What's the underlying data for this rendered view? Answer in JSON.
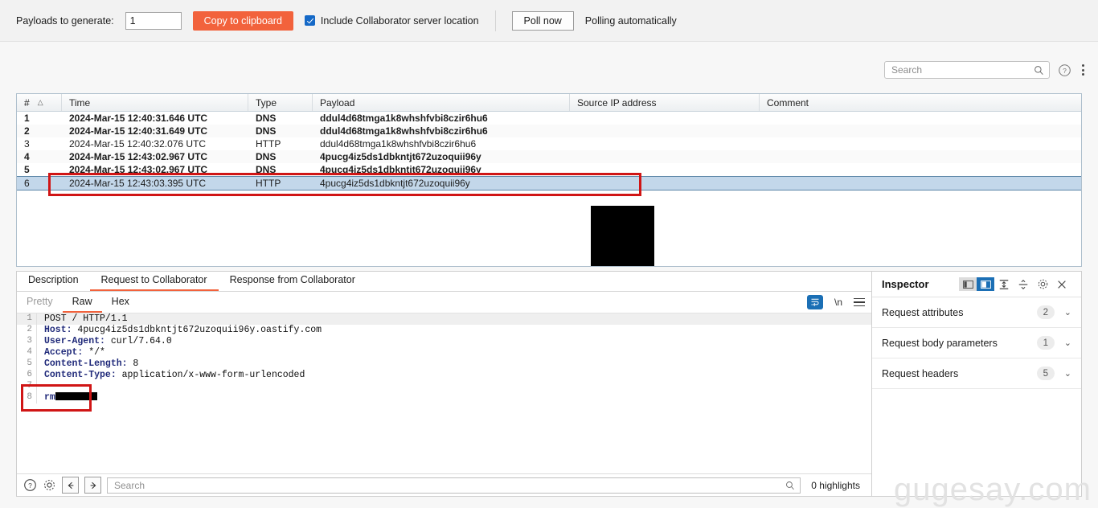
{
  "toolbar": {
    "payloads_label": "Payloads to generate:",
    "payloads_value": "1",
    "copy_button": "Copy to clipboard",
    "include_location_label": "Include Collaborator server location",
    "include_location_checked": true,
    "poll_now_button": "Poll now",
    "polling_status": "Polling automatically",
    "accent_color": "#f2623c"
  },
  "search": {
    "placeholder": "Search",
    "value": "",
    "icon": "search-icon",
    "help_icon": "help-circle-icon",
    "overflow_icon": "more-vertical-icon"
  },
  "table": {
    "columns": [
      "#",
      "Time",
      "Type",
      "Payload",
      "Source IP address",
      "Comment"
    ],
    "sort_column": "#",
    "sort_direction": "ascending",
    "rows": [
      {
        "num": "1",
        "time": "2024-Mar-15 12:40:31.646 UTC",
        "type": "DNS",
        "payload": "ddul4d68tmga1k8whshfvbi8czir6hu6",
        "source_ip": "",
        "comment": "",
        "bold": true,
        "selected": false
      },
      {
        "num": "2",
        "time": "2024-Mar-15 12:40:31.649 UTC",
        "type": "DNS",
        "payload": "ddul4d68tmga1k8whshfvbi8czir6hu6",
        "source_ip": "",
        "comment": "",
        "bold": true,
        "selected": false
      },
      {
        "num": "3",
        "time": "2024-Mar-15 12:40:32.076 UTC",
        "type": "HTTP",
        "payload": "ddul4d68tmga1k8whshfvbi8czir6hu6",
        "source_ip": "",
        "comment": "",
        "bold": false,
        "selected": false
      },
      {
        "num": "4",
        "time": "2024-Mar-15 12:43:02.967 UTC",
        "type": "DNS",
        "payload": "4pucg4iz5ds1dbkntjt672uzoquii96y",
        "source_ip": "",
        "comment": "",
        "bold": true,
        "selected": false
      },
      {
        "num": "5",
        "time": "2024-Mar-15 12:43:02.967 UTC",
        "type": "DNS",
        "payload": "4pucg4iz5ds1dbkntjt672uzoquii96y",
        "source_ip": "",
        "comment": "",
        "bold": true,
        "selected": false
      },
      {
        "num": "6",
        "time": "2024-Mar-15 12:43:03.395 UTC",
        "type": "HTTP",
        "payload": "4pucg4iz5ds1dbkntjt672uzoquii96y",
        "source_ip": "",
        "comment": "",
        "bold": false,
        "selected": true
      }
    ],
    "selected_row_color": "#c3d7ea",
    "redaction": "source-ip-redacted"
  },
  "annotations": {
    "color": "#d01515",
    "row_highlight": "selected-interaction-row",
    "body_highlight": "request-body-line"
  },
  "message_tabs": {
    "tabs": [
      {
        "label": "Description",
        "active": false
      },
      {
        "label": "Request to Collaborator",
        "active": true
      },
      {
        "label": "Response from Collaborator",
        "active": false
      }
    ]
  },
  "editor": {
    "view_tabs": [
      {
        "label": "Pretty",
        "active": false,
        "dim": true
      },
      {
        "label": "Raw",
        "active": true,
        "dim": false
      },
      {
        "label": "Hex",
        "active": false,
        "dim": false
      }
    ],
    "word_wrap_icon": "word-wrap-icon",
    "newline_label": "\\n",
    "menu_icon": "hamburger-menu-icon",
    "lines": [
      {
        "n": "1",
        "key": "",
        "text": "POST / HTTP/1.1",
        "highlight": true,
        "redacted": false
      },
      {
        "n": "2",
        "key": "Host:",
        "text": " 4pucg4iz5ds1dbkntjt672uzoquii96y.oastify.com",
        "highlight": false,
        "redacted": false
      },
      {
        "n": "3",
        "key": "User-Agent:",
        "text": " curl/7.64.0",
        "highlight": false,
        "redacted": false
      },
      {
        "n": "4",
        "key": "Accept:",
        "text": " */*",
        "highlight": false,
        "redacted": false
      },
      {
        "n": "5",
        "key": "Content-Length:",
        "text": " 8",
        "highlight": false,
        "redacted": false
      },
      {
        "n": "6",
        "key": "Content-Type:",
        "text": " application/x-www-form-urlencoded",
        "highlight": false,
        "redacted": false
      },
      {
        "n": "7",
        "key": "",
        "text": "",
        "highlight": false,
        "redacted": false
      },
      {
        "n": "8",
        "key": "rm",
        "text": "",
        "highlight": false,
        "redacted": true
      }
    ]
  },
  "find_bar": {
    "help_icon": "help-circle-icon",
    "settings_icon": "gear-icon",
    "prev_icon": "arrow-left-icon",
    "next_icon": "arrow-right-icon",
    "placeholder": "Search",
    "value": "",
    "search_icon": "search-icon",
    "highlights_text": "0 highlights"
  },
  "inspector": {
    "title": "Inspector",
    "layout_left_icon": "layout-side-icon",
    "layout_right_icon": "layout-split-icon",
    "layout_selected": "layout-split-icon",
    "collapse_icon": "collapse-all-icon",
    "expand_icon": "expand-all-icon",
    "settings_icon": "gear-icon",
    "close_icon": "close-icon",
    "sections": [
      {
        "label": "Request attributes",
        "count": "2"
      },
      {
        "label": "Request body parameters",
        "count": "1"
      },
      {
        "label": "Request headers",
        "count": "5"
      }
    ]
  },
  "watermark": {
    "text": "gugesay.com"
  }
}
